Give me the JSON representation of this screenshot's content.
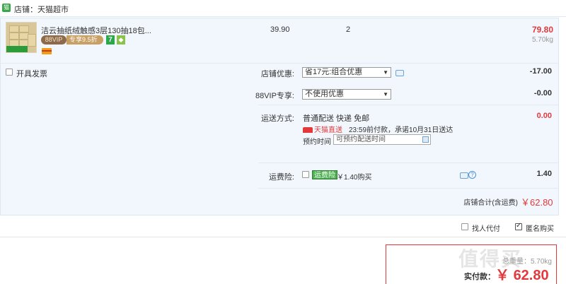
{
  "shop": {
    "icon": "tmall-icon",
    "label": "店铺：",
    "name": "天猫超市"
  },
  "item": {
    "title": "洁云抽纸绒触感3层130抽18包...",
    "vip_badge": "88VIP",
    "vip_discount": "专享9.5折",
    "badge_7": "7",
    "unit_price": "39.90",
    "quantity": "2",
    "subtotal": "79.80",
    "weight": "5.70kg"
  },
  "invoice": {
    "label": "开具发票",
    "checked": false
  },
  "shop_discount": {
    "label": "店铺优惠:",
    "selected": "省17元:组合优惠",
    "value": "-17.00"
  },
  "vip_offer": {
    "label": "88VIP专享:",
    "selected": "不使用优惠",
    "value": "-0.00"
  },
  "shipping": {
    "label": "运送方式:",
    "method": "普通配送 快递 免邮",
    "tmall_logo": "天猫直送",
    "promise": "23:59前付款，承诺10月31日送达",
    "schedule_label": "预约时间",
    "schedule_placeholder": "可预约配送时间",
    "value": "0.00"
  },
  "insurance": {
    "label": "运费险:",
    "tag": "运费险",
    "price": "￥1.40购买",
    "value": "1.40",
    "checked": false
  },
  "shop_total": {
    "label": "店铺合计(含运费)",
    "value": "￥62.80"
  },
  "bottom": {
    "proxy_label": "找人代付",
    "proxy_checked": false,
    "anon_label": "匿名购买",
    "anon_checked": true
  },
  "payment": {
    "weight_label": "总重量：",
    "weight": "5.70kg",
    "label": "实付款：",
    "currency": "￥",
    "amount": "62.80"
  },
  "watermark": "值得买",
  "colors": {
    "accent_red": "#e4393c",
    "panel_bg": "#f2f7fd",
    "tmall_green": "#3aa64a"
  }
}
